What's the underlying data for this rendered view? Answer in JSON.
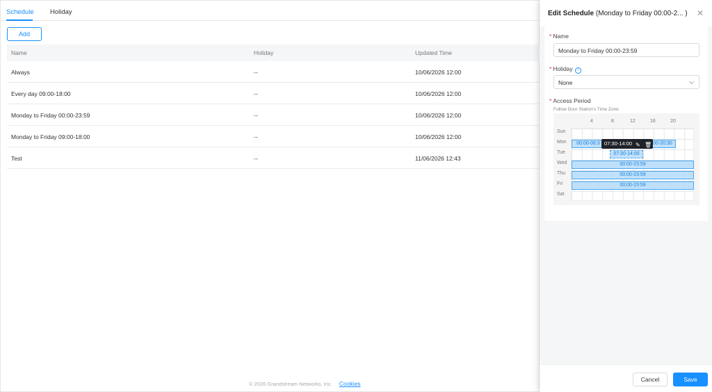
{
  "tabs": [
    {
      "label": "Schedule"
    },
    {
      "label": "Holiday"
    }
  ],
  "add_label": "Add",
  "table": {
    "headers": {
      "name": "Name",
      "holiday": "Holiday",
      "updated": "Updated Time"
    },
    "rows": [
      {
        "name": "Always",
        "holiday": "--",
        "updated": "10/06/2026 12:00"
      },
      {
        "name": "Every day 09:00-18:00",
        "holiday": "--",
        "updated": "10/06/2026 12:00"
      },
      {
        "name": "Monday to Friday 00:00-23:59",
        "holiday": "--",
        "updated": "10/06/2026 12:00"
      },
      {
        "name": "Monday to Friday 09:00-18:00",
        "holiday": "--",
        "updated": "10/06/2026 12:00"
      },
      {
        "name": "Test",
        "holiday": "--",
        "updated": "11/06/2026 12:43"
      }
    ]
  },
  "footer": {
    "copyright": "© 2026 Grandstream Networks, Inc.",
    "cookies": "Cookies"
  },
  "drawer": {
    "title_bold": "Edit Schedule",
    "title_rest": "(Monday to Friday 00:00-2... )",
    "name_label": "Name",
    "name_value": "Monday to Friday 00:00-23:59",
    "holiday_label": "Holiday",
    "holiday_value": "None",
    "access_label": "Access Period",
    "access_note": "Follow Door Station's Time Zone",
    "hours": [
      "4",
      "8",
      "12",
      "16",
      "20"
    ],
    "days": [
      "Sun",
      "Mon",
      "Tue",
      "Wed",
      "Thu",
      "Fri",
      "Sat"
    ],
    "periods": {
      "mon_a": "00:00-06:3",
      "mon_b": "00-20:30",
      "tue": "07:30-14:00",
      "wed": "00:00-23:59",
      "thu": "00:00-23:59",
      "fri": "00:00-23:59"
    },
    "tooltip": "07:30-14:00",
    "cancel_label": "Cancel",
    "save_label": "Save"
  }
}
